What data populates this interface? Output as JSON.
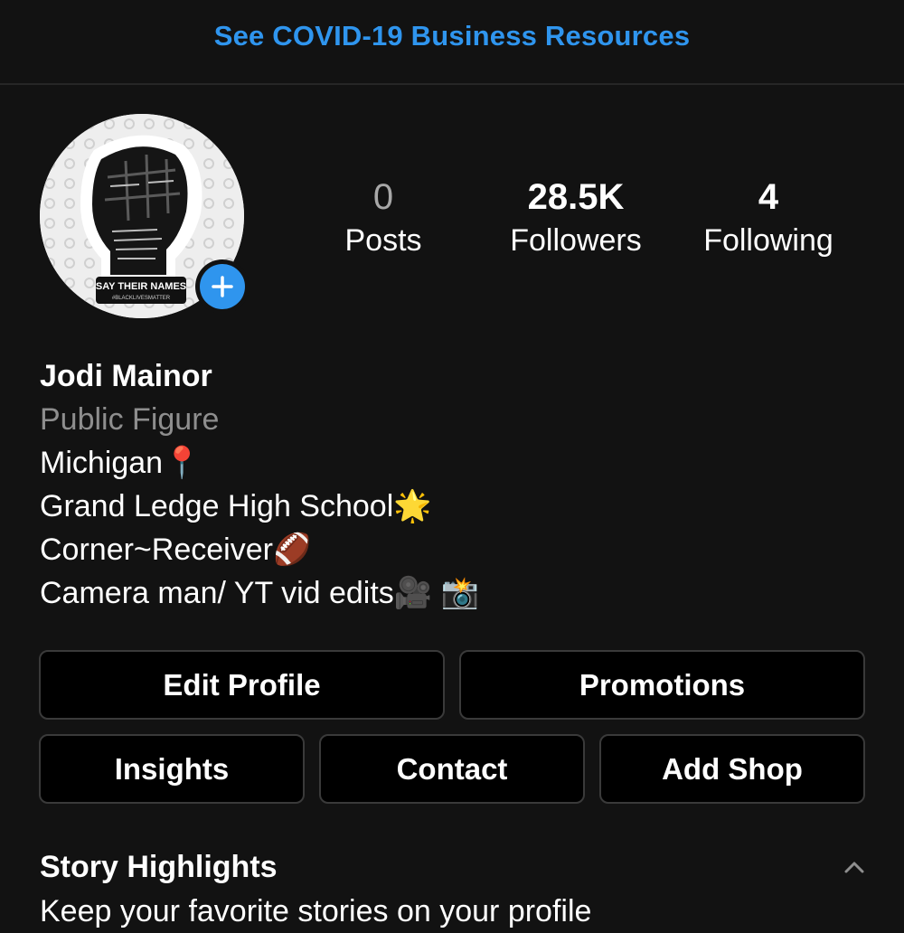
{
  "banner": {
    "link_text": "See COVID-19 Business Resources",
    "link_color": "#2f95ee"
  },
  "profile": {
    "avatar": {
      "sticker_text": "SAY THEIR NAMES",
      "sticker_subtext": "#BLACKLIVESMATTER",
      "icon": "raised-fist-icon"
    },
    "add_story_icon": "plus-icon",
    "stats": {
      "posts": {
        "value": "0",
        "label": "Posts"
      },
      "followers": {
        "value": "28.5K",
        "label": "Followers"
      },
      "following": {
        "value": "4",
        "label": "Following"
      }
    },
    "name": "Jodi Mainor",
    "category": "Public Figure",
    "bio_lines": [
      "Michigan📍",
      "Grand Ledge High School🌟",
      "Corner~Receiver🏈",
      "Camera man/ YT vid edits🎥 📸"
    ]
  },
  "buttons": {
    "edit_profile": "Edit Profile",
    "promotions": "Promotions",
    "insights": "Insights",
    "contact": "Contact",
    "add_shop": "Add Shop"
  },
  "highlights": {
    "title": "Story Highlights",
    "subtitle": "Keep your favorite stories on your profile",
    "toggle_icon": "chevron-up-icon"
  },
  "colors": {
    "background": "#121212",
    "accent": "#2f95ee",
    "muted_text": "#8e8e8e",
    "button_border": "#3a3a3a"
  }
}
